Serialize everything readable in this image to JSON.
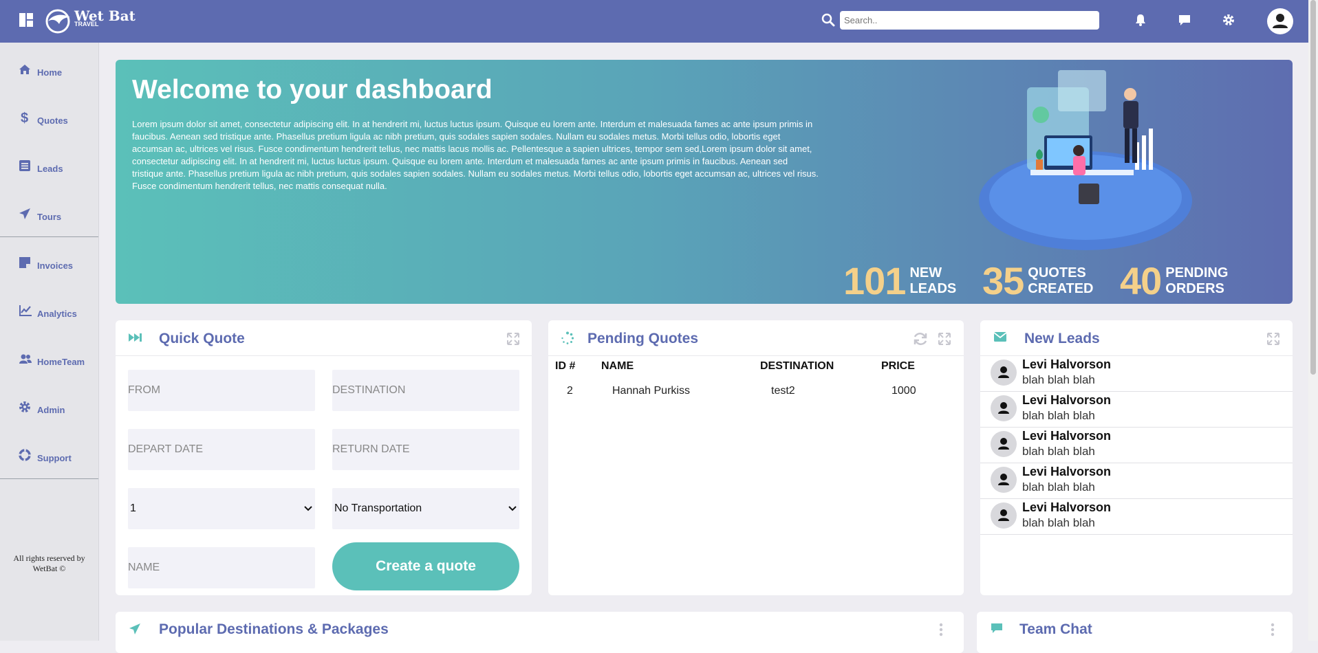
{
  "topbar": {
    "brand_name": "Wet Bat",
    "brand_sub": "TRAVEL",
    "search_placeholder": "Search..",
    "accent": "#5d6bb0"
  },
  "sidebar": {
    "items": [
      {
        "label": "Home",
        "icon": "home-icon"
      },
      {
        "label": "Quotes",
        "icon": "dollar-icon"
      },
      {
        "label": "Leads",
        "icon": "list-icon"
      },
      {
        "label": "Tours",
        "icon": "paper-plane-icon"
      },
      {
        "label": "Invoices",
        "icon": "sticky-note-icon"
      },
      {
        "label": "Analytics",
        "icon": "chart-line-icon"
      },
      {
        "label": "HomeTeam",
        "icon": "users-icon"
      },
      {
        "label": "Admin",
        "icon": "gear-icon"
      },
      {
        "label": "Support",
        "icon": "lifebuoy-icon"
      }
    ],
    "footer_line1": "All rights reserved by",
    "footer_line2": "WetBat ©"
  },
  "hero": {
    "title": "Welcome to your dashboard",
    "body": "Lorem ipsum dolor sit amet, consectetur adipiscing elit. In at hendrerit mi, luctus luctus ipsum. Quisque eu lorem ante. Interdum et malesuada fames ac ante ipsum primis in faucibus. Aenean sed tristique ante. Phasellus pretium ligula ac nibh pretium, quis sodales sapien sodales. Nullam eu sodales metus. Morbi tellus odio, lobortis eget accumsan ac, ultrices vel risus. Fusce condimentum hendrerit tellus, nec mattis lacus mollis ac. Pellentesque a sapien ultrices, tempor sem sed,Lorem ipsum dolor sit amet, consectetur adipiscing elit. In at hendrerit mi, luctus luctus ipsum. Quisque eu lorem ante. Interdum et malesuada fames ac ante ipsum primis in faucibus. Aenean sed tristique ante. Phasellus pretium ligula ac nibh pretium, quis sodales sapien sodales. Nullam eu sodales metus. Morbi tellus odio, lobortis eget accumsan ac, ultrices vel risus. Fusce condimentum hendrerit tellus, nec mattis consequat nulla.",
    "stats": [
      {
        "value": "101",
        "line1": "NEW",
        "line2": "LEADS"
      },
      {
        "value": "35",
        "line1": "QUOTES",
        "line2": "CREATED"
      },
      {
        "value": "40",
        "line1": "PENDING",
        "line2": "ORDERS"
      }
    ],
    "stat_color": "#f4d08a"
  },
  "quick_quote": {
    "title": "Quick Quote",
    "from_placeholder": "FROM",
    "destination_placeholder": "DESTINATION",
    "depart_placeholder": "DEPART DATE",
    "return_placeholder": "RETURN DATE",
    "travelers_value": "1",
    "transport_value": "No Transportation",
    "name_placeholder": "NAME",
    "create_label": "Create a quote"
  },
  "pending_quotes": {
    "title": "Pending Quotes",
    "columns": [
      "ID #",
      "NAME",
      "DESTINATION",
      "PRICE"
    ],
    "rows": [
      {
        "id": "2",
        "name": "Hannah Purkiss",
        "destination": "test2",
        "price": "1000"
      }
    ]
  },
  "new_leads": {
    "title": "New Leads",
    "items": [
      {
        "name": "Levi Halvorson",
        "msg": "blah blah blah"
      },
      {
        "name": "Levi Halvorson",
        "msg": "blah blah blah"
      },
      {
        "name": "Levi Halvorson",
        "msg": "blah blah blah"
      },
      {
        "name": "Levi Halvorson",
        "msg": "blah blah blah"
      },
      {
        "name": "Levi Halvorson",
        "msg": "blah blah blah"
      }
    ]
  },
  "popular": {
    "title": "Popular Destinations & Packages"
  },
  "team_chat": {
    "title": "Team Chat"
  },
  "teal": "#5bc0b9"
}
